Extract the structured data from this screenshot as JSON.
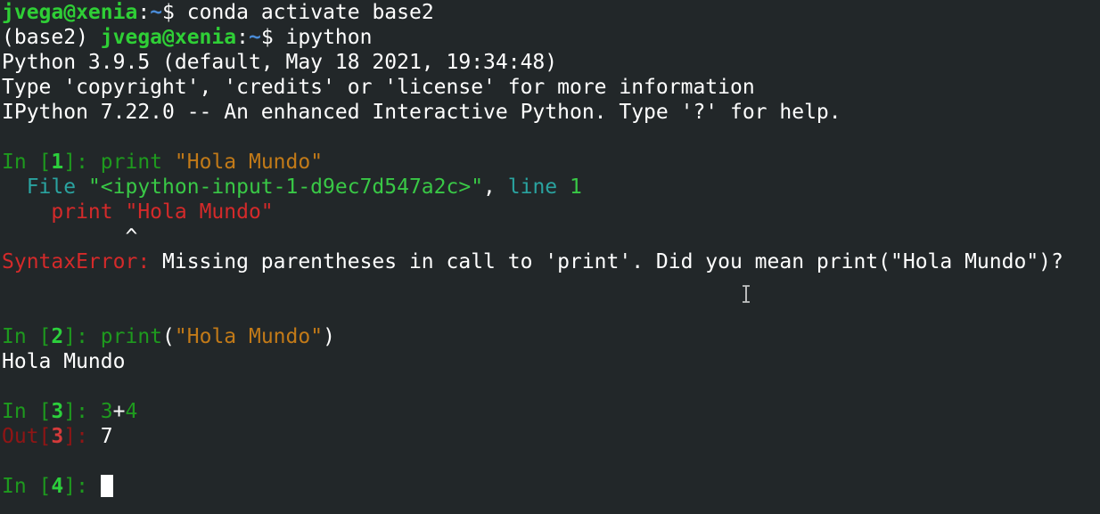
{
  "session": {
    "cmd1": {
      "user": "jvega@xenia",
      "sep": ":",
      "path": "~",
      "dollar": "$ ",
      "command": "conda activate base2"
    },
    "cmd2": {
      "env": "(base2) ",
      "user": "jvega@xenia",
      "sep": ":",
      "path": "~",
      "dollar": "$ ",
      "command": "ipython"
    },
    "banner": [
      "Python 3.9.5 (default, May 18 2021, 19:34:48)",
      "Type 'copyright', 'credits' or 'license' for more information",
      "IPython 7.22.0 -- An enhanced Interactive Python. Type '?' for help."
    ]
  },
  "cells": {
    "in1": {
      "prompt_in": "In [",
      "num": "1",
      "prompt_close": "]: ",
      "code_kw": "print",
      "code_space": " ",
      "code_str": "\"Hola Mundo\""
    },
    "traceback": {
      "file_label": "  File ",
      "file_name": "\"<ipython-input-1-d9ec7d547a2c>\"",
      "comma": ", ",
      "line_label": "line ",
      "line_num": "1",
      "code_indent": "    ",
      "code_kw": "print",
      "code_rest": " \"Hola Mundo\"",
      "caret": "          ^",
      "error_type": "SyntaxError:",
      "error_msg": " Missing parentheses in call to 'print'. Did you mean print(\"Hola Mundo\")?"
    },
    "in2": {
      "prompt_in": "In [",
      "num": "2",
      "prompt_close": "]: ",
      "code_kw": "print",
      "open_paren": "(",
      "code_str": "\"Hola Mundo\"",
      "close_paren": ")",
      "output": "Hola Mundo"
    },
    "in3": {
      "prompt_in": "In [",
      "num": "3",
      "prompt_close": "]: ",
      "a": "3",
      "op": "+",
      "b": "4",
      "out_prompt": "Out[",
      "out_num": "3",
      "out_close": "]: ",
      "out_value": "7"
    },
    "in4": {
      "prompt_in": "In [",
      "num": "4",
      "prompt_close": "]: "
    }
  },
  "colors": {
    "background": "#222729",
    "prompt_green": "#1e9a1e",
    "string_orange": "#c27a18",
    "error_red": "#d42a2a",
    "user_green": "#2fcf36",
    "path_blue": "#4a8bd6"
  },
  "icons": {
    "mouse_cursor": "ibeam-cursor-icon"
  }
}
